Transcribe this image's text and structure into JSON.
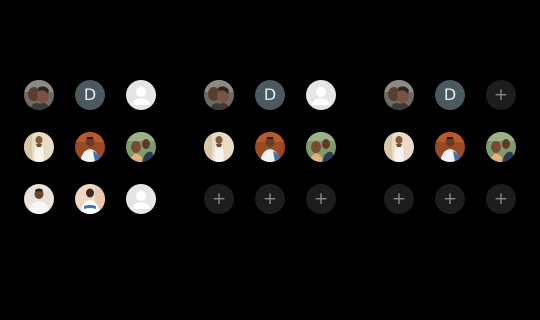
{
  "panels": [
    {
      "slots": [
        {
          "kind": "photo",
          "variant": "couple",
          "icon": "contact-photo"
        },
        {
          "kind": "letter",
          "text": "D"
        },
        {
          "kind": "default",
          "icon": "default-avatar-icon"
        },
        {
          "kind": "photo",
          "variant": "woman-white",
          "icon": "contact-photo"
        },
        {
          "kind": "photo",
          "variant": "man-orange",
          "icon": "contact-photo"
        },
        {
          "kind": "photo",
          "variant": "child-green",
          "icon": "contact-photo"
        },
        {
          "kind": "photo",
          "variant": "man-light",
          "icon": "contact-photo"
        },
        {
          "kind": "photo",
          "variant": "man-peach",
          "icon": "contact-photo"
        },
        {
          "kind": "default",
          "icon": "default-avatar-icon"
        }
      ]
    },
    {
      "slots": [
        {
          "kind": "photo",
          "variant": "couple",
          "icon": "contact-photo"
        },
        {
          "kind": "letter",
          "text": "D"
        },
        {
          "kind": "default",
          "icon": "default-avatar-icon"
        },
        {
          "kind": "photo",
          "variant": "woman-white",
          "icon": "contact-photo"
        },
        {
          "kind": "photo",
          "variant": "man-orange",
          "icon": "contact-photo"
        },
        {
          "kind": "photo",
          "variant": "child-green",
          "icon": "contact-photo"
        },
        {
          "kind": "add",
          "text": "+"
        },
        {
          "kind": "add",
          "text": "+"
        },
        {
          "kind": "add",
          "text": "+"
        }
      ]
    },
    {
      "slots": [
        {
          "kind": "photo",
          "variant": "couple",
          "icon": "contact-photo"
        },
        {
          "kind": "letter",
          "text": "D"
        },
        {
          "kind": "add",
          "text": "+"
        },
        {
          "kind": "photo",
          "variant": "woman-white",
          "icon": "contact-photo"
        },
        {
          "kind": "photo",
          "variant": "man-orange",
          "icon": "contact-photo"
        },
        {
          "kind": "photo",
          "variant": "child-green",
          "icon": "contact-photo"
        },
        {
          "kind": "add",
          "text": "+"
        },
        {
          "kind": "add",
          "text": "+"
        },
        {
          "kind": "add",
          "text": "+"
        }
      ]
    }
  ],
  "colors": {
    "background": "#000000",
    "letter_bg": "#4a5960",
    "default_bg": "#e6e6e6",
    "add_bg": "#1d1d1d",
    "add_fg": "#8a8a8a"
  }
}
